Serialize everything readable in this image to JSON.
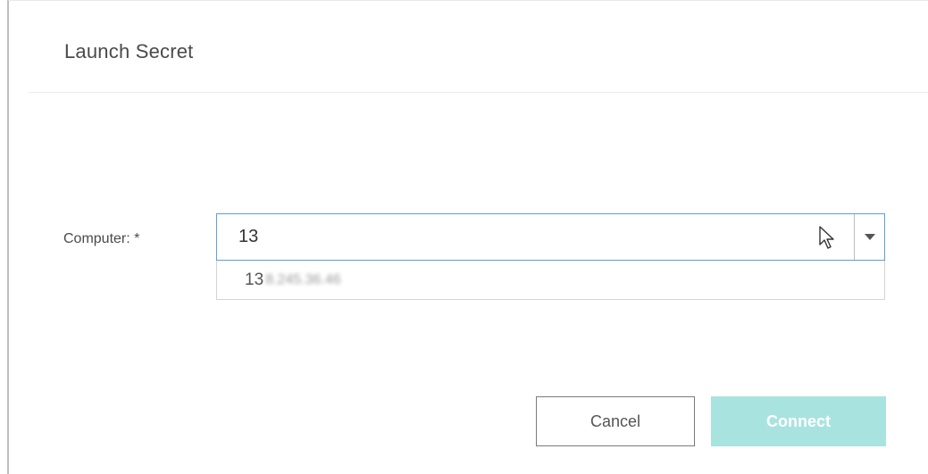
{
  "dialog": {
    "title": "Launch Secret"
  },
  "form": {
    "computer_label": "Computer: *",
    "computer_value": "13",
    "dropdown_toggle_icon": "chevron-down-icon",
    "suggestions": [
      {
        "visible_prefix": "13",
        "obscured_text": "8.245.36.46"
      }
    ]
  },
  "actions": {
    "cancel_label": "Cancel",
    "connect_label": "Connect",
    "connect_disabled": true,
    "connect_color": "#a9e3df"
  },
  "pointer": {
    "icon": "mouse-pointer-icon"
  }
}
